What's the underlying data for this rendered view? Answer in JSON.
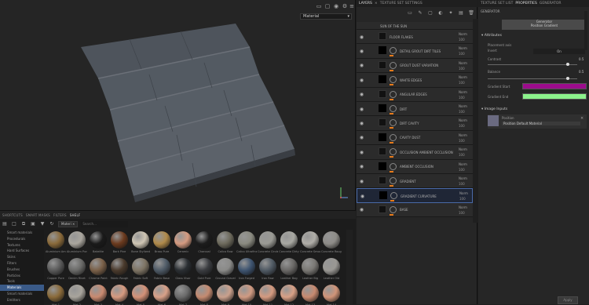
{
  "viewport": {
    "view_mode": "Material",
    "view_mode_icon": "chevron-down-icon",
    "top_icons": [
      "screen-icon",
      "window-icon",
      "camera-icon",
      "grid-icon",
      "sun-icon",
      "settings-icon",
      "bars-icon"
    ]
  },
  "shelf": {
    "tabs": [
      {
        "label": "Shortcuts"
      },
      {
        "label": "Smart masks"
      },
      {
        "label": "Filters"
      },
      {
        "label": "Shelf"
      }
    ],
    "filter_label": "Materi",
    "search_placeholder": "Search...",
    "categories": [
      {
        "label": "Smart materials"
      },
      {
        "label": "Procedurals"
      },
      {
        "label": "Textures"
      },
      {
        "label": "Hard Surfaces"
      },
      {
        "label": "Skins"
      },
      {
        "label": "Filters"
      },
      {
        "label": "Brushes"
      },
      {
        "label": "Particles"
      },
      {
        "label": "Tools"
      },
      {
        "label": "Materials"
      },
      {
        "label": "Smart materials"
      },
      {
        "label": "Emitters"
      }
    ],
    "active_category_index": 9,
    "materials_row1": [
      {
        "name": "Aluminium Amor",
        "color": "#8a6a3a"
      },
      {
        "name": "Aluminium Pure",
        "color": "#aaa69e"
      },
      {
        "name": "Bakelite",
        "color": "#1a1a1a"
      },
      {
        "name": "Bark Pine",
        "color": "#6b3a1e"
      },
      {
        "name": "Bone Stylized",
        "color": "#cfc6b4"
      },
      {
        "name": "Brass Pure",
        "color": "#b08a4a"
      },
      {
        "name": "Ceramic",
        "color": "#d49a80"
      },
      {
        "name": "Charcoal",
        "color": "#1c1c1c"
      },
      {
        "name": "Calico Raw",
        "color": "#6d6a5c"
      },
      {
        "name": "Calico Ultrafine",
        "color": "#8a8a80"
      },
      {
        "name": "Concrete Cinder",
        "color": "#9a9a94"
      },
      {
        "name": "Concrete Dirty",
        "color": "#a8a8a2"
      },
      {
        "name": "Concrete Smooth",
        "color": "#b0aea8"
      },
      {
        "name": "Concrete Rough",
        "color": "#8e8c88"
      }
    ],
    "materials_row2": [
      {
        "name": "Copper Pure",
        "color": "#5a5a5a"
      },
      {
        "name": "Denim Rivet",
        "color": "#6a6a68"
      },
      {
        "name": "Chrome Paint",
        "color": "#7a6048"
      },
      {
        "name": "Fabric Rough",
        "color": "#4a3a2c"
      },
      {
        "name": "Fabric Soft",
        "color": "#7e7464"
      },
      {
        "name": "Fabric Base",
        "color": "#4e5a66"
      },
      {
        "name": "Glass Visor",
        "color": "#2a2e32"
      },
      {
        "name": "Gold Pure",
        "color": "#3a3c40"
      },
      {
        "name": "Ground Gravel",
        "color": "#8a8a88"
      },
      {
        "name": "Iron Forged",
        "color": "#3e5470"
      },
      {
        "name": "Iron Raw",
        "color": "#505a64"
      },
      {
        "name": "Leather Bag",
        "color": "#6a6866"
      },
      {
        "name": "Leather Big",
        "color": "#7a7874"
      },
      {
        "name": "Leather Old",
        "color": "#9a9894"
      }
    ],
    "materials_row3": [
      {
        "name": "Mat 1",
        "color": "#8a6a3a"
      },
      {
        "name": "Mat 2",
        "color": "#a8a49c"
      },
      {
        "name": "Mat 3",
        "color": "#c98a70"
      },
      {
        "name": "Mat 4",
        "color": "#d69a80"
      },
      {
        "name": "Mat 5",
        "color": "#d49278"
      },
      {
        "name": "Mat 6",
        "color": "#d8a088"
      },
      {
        "name": "Mat 7",
        "color": "#6a6a6a"
      },
      {
        "name": "Mat 8",
        "color": "#c48a70"
      },
      {
        "name": "Mat 9",
        "color": "#caa08c"
      },
      {
        "name": "Mat 10",
        "color": "#d09a82"
      },
      {
        "name": "Mat 11",
        "color": "#d49a80"
      },
      {
        "name": "Mat 12",
        "color": "#d8a086"
      },
      {
        "name": "Mat 13",
        "color": "#c88a70"
      },
      {
        "name": "Mat 14",
        "color": "#d09478"
      }
    ]
  },
  "layers": {
    "tabs": [
      {
        "label": "Layers"
      },
      {
        "label": "Texture Set Settings"
      }
    ],
    "rows": [
      {
        "name": "Sun Of The Sun",
        "blend": "",
        "opacity": ""
      },
      {
        "name": "Floor Flakes",
        "blend": "Norm",
        "opacity": "100"
      },
      {
        "name": "Detail Grout Dirt Tiles",
        "blend": "Norm",
        "opacity": "100"
      },
      {
        "name": "Grout Dust Variation",
        "blend": "Norm",
        "opacity": "100"
      },
      {
        "name": "White Edges",
        "blend": "Norm",
        "opacity": "100"
      },
      {
        "name": "Angular Edges",
        "blend": "Norm",
        "opacity": "100"
      },
      {
        "name": "Dirt",
        "blend": "Norm",
        "opacity": "100"
      },
      {
        "name": "Dirt Cavity",
        "blend": "Norm",
        "opacity": "100"
      },
      {
        "name": "Cavity Dust",
        "blend": "Norm",
        "opacity": "100"
      },
      {
        "name": "Occlusion Ambient Occlusion",
        "blend": "Norm",
        "opacity": "100"
      },
      {
        "name": "Ambient Occlusion",
        "blend": "Norm",
        "opacity": "100"
      },
      {
        "name": "Gradient",
        "blend": "Norm",
        "opacity": "100"
      },
      {
        "name": "Gradient Curvature",
        "blend": "Norm",
        "opacity": "100"
      },
      {
        "name": "Base",
        "blend": "Norm",
        "opacity": "100"
      }
    ]
  },
  "properties": {
    "tabs": [
      {
        "label": "Texture Set List"
      },
      {
        "label": "Properties"
      },
      {
        "label": "Generator"
      }
    ],
    "title": "Generator",
    "generator_box_line1": "Generator",
    "generator_box_line2": "Position Gradient",
    "attributes_header": "Attributes",
    "attr_label_placement": "Placement axis",
    "attr_label_invert": "Invert",
    "attr_value_invert": "On",
    "attr_label_contrast": "Contrast",
    "attr_value_contrast": "0.5",
    "attr_label_balance": "Balance",
    "attr_value_balance": "0.5",
    "label_color_start": "Gradient Start",
    "color_start": "#9b0c8c",
    "label_color_end": "Gradient End",
    "color_end": "#8cf28c",
    "image_inputs_header": "Image Inputs",
    "image_input_name": "Position",
    "image_input_value": "Position Default Material",
    "apply_label": "Apply"
  }
}
